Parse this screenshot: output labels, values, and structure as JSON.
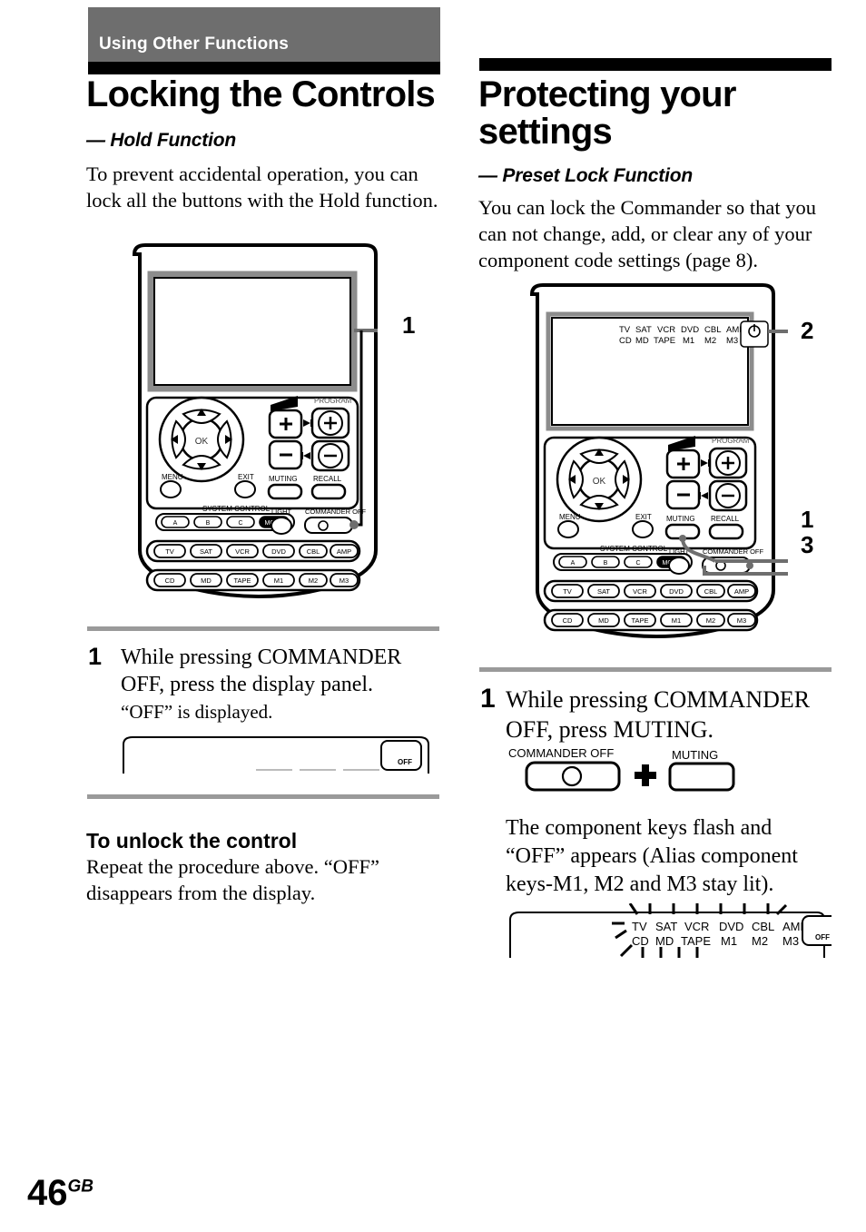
{
  "page": {
    "number": "46",
    "number_suffix": "GB"
  },
  "chapter": {
    "label": "Using Other Functions"
  },
  "left_column": {
    "title": "Locking the Controls",
    "subtitle": "— Hold Function",
    "intro": "To prevent accidental operation, you can lock all the buttons with the Hold function.",
    "callouts": [
      "1"
    ],
    "step": {
      "number": "1",
      "text": "While pressing COMMANDER OFF, press the display panel.",
      "sub": "“OFF” is displayed."
    },
    "unlock": {
      "heading": "To unlock the control",
      "body": "Repeat the procedure above. “OFF” disappears from the display."
    },
    "display_figure": {
      "off_label": "OFF"
    }
  },
  "right_column": {
    "title": "Protecting your settings",
    "subtitle": "— Preset Lock Function",
    "intro": "You can lock the Commander so that you can not change, add, or clear any of your component code settings (page 8).",
    "callouts": [
      "2",
      "1",
      "3"
    ],
    "step": {
      "number": "1",
      "text": "While pressing COMMANDER OFF, press MUTING.",
      "result": "The component keys flash and “OFF” appears (Alias component keys-M1, M2 and M3 stay lit)."
    },
    "key_diagram": {
      "commander_off_label": "COMMANDER OFF",
      "plus_symbol": "+",
      "muting_label": "MUTING"
    },
    "display_figure": {
      "row1": [
        "TV",
        "SAT",
        "VCR",
        "DVD",
        "CBL",
        "AMP"
      ],
      "row2": [
        "CD",
        "MD",
        "TAPE",
        "M1",
        "M2",
        "M3"
      ],
      "off_label": "OFF"
    }
  },
  "remote": {
    "display_row1": [
      "TV",
      "SAT",
      "VCR",
      "DVD",
      "CBL",
      "AMP"
    ],
    "display_row2": [
      "CD",
      "MD",
      "TAPE",
      "M1",
      "M2",
      "M3"
    ],
    "ok_label": "OK",
    "menu_label": "MENU",
    "exit_label": "EXIT",
    "system_control_label": "SYSTEM CONTROL",
    "system_keys": [
      "A",
      "B",
      "C",
      "MORE"
    ],
    "volume_plus": "+",
    "volume_minus": "−",
    "program_label": "PROGRAM",
    "muting_label": "MUTING",
    "recall_label": "RECALL",
    "light_label": "LIGHT",
    "commander_off_label": "COMMANDER OFF",
    "component_row1": [
      "TV",
      "SAT",
      "VCR",
      "DVD",
      "CBL",
      "AMP"
    ],
    "component_row2": [
      "CD",
      "MD",
      "TAPE",
      "M1",
      "M2",
      "M3"
    ]
  },
  "colors": {
    "banner_gray": "#6e6e6e",
    "rule_black": "#000000",
    "step_rule": "#9a9a9a"
  }
}
